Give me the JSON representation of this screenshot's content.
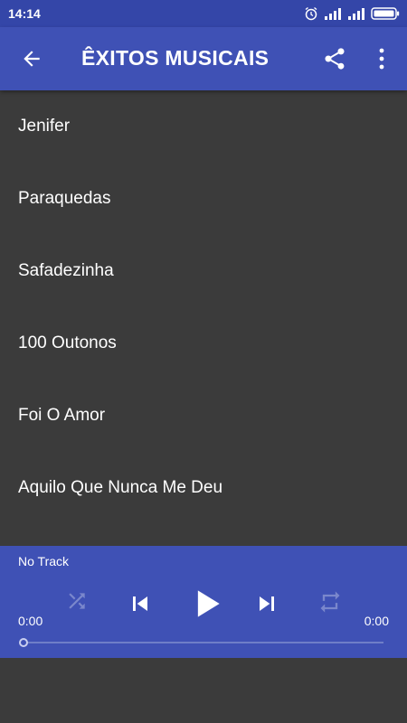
{
  "status_bar": {
    "time": "14:14",
    "icons": [
      "alarm-icon",
      "signal-icon",
      "signal-icon",
      "battery-icon"
    ]
  },
  "app_bar": {
    "title": "ÊXITOS MUSICAIS",
    "icons": [
      "back-arrow-icon",
      "share-icon",
      "more-vert-icon"
    ]
  },
  "songs": [
    "Jenifer",
    "Paraquedas",
    "Safadezinha",
    "100 Outonos",
    "Foi O Amor",
    "Aquilo Que Nunca Me Deu"
  ],
  "player": {
    "track": "No Track",
    "time_elapsed": "0:00",
    "time_total": "0:00",
    "progress": 0,
    "controls": [
      "shuffle-icon",
      "previous-icon",
      "play-icon",
      "next-icon",
      "repeat-icon"
    ]
  },
  "colors": {
    "primary": "#3f51b5",
    "status_bar": "#3446a8",
    "background": "#3b3b3b",
    "text": "#ffffff",
    "disabled_icon": "#7a87cc"
  }
}
